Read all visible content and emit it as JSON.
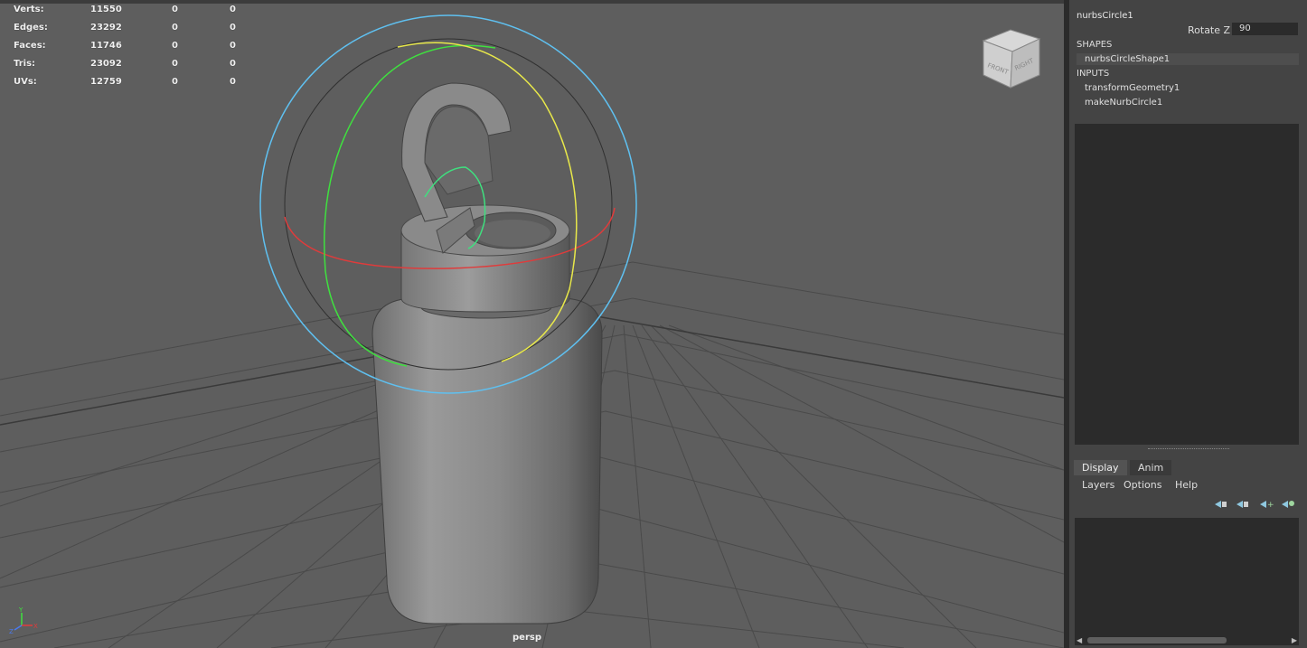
{
  "hud": {
    "rows": [
      {
        "label": "Verts:",
        "v1": "11550",
        "v2": "0",
        "v3": "0"
      },
      {
        "label": "Edges:",
        "v1": "23292",
        "v2": "0",
        "v3": "0"
      },
      {
        "label": "Faces:",
        "v1": "11746",
        "v2": "0",
        "v3": "0"
      },
      {
        "label": "Tris:",
        "v1": "23092",
        "v2": "0",
        "v3": "0"
      },
      {
        "label": "UVs:",
        "v1": "12759",
        "v2": "0",
        "v3": "0"
      }
    ]
  },
  "viewport": {
    "camera_label": "persp",
    "viewcube": {
      "front": "FRONT",
      "right": "RIGHT"
    },
    "axis": {
      "y": "Y",
      "x": "X",
      "z": "Z"
    },
    "colors": {
      "background": "#5e5e5e",
      "grid": "#4a4a4a",
      "rotate_x": "#e03b3b",
      "rotate_y": "#3fe03f",
      "rotate_z": "#e8e84a",
      "view_ring": "#5fc0f0"
    }
  },
  "channel_box": {
    "object_name": "nurbsCircle1",
    "attribute": {
      "label": "Rotate Z",
      "value": "90"
    },
    "shapes_header": "SHAPES",
    "shape_node": "nurbsCircleShape1",
    "inputs_header": "INPUTS",
    "input_nodes": [
      "transformGeometry1",
      "makeNurbCircle1"
    ]
  },
  "layer_editor": {
    "tabs": [
      "Display",
      "Anim"
    ],
    "active_tab": "Display",
    "menus": [
      "Layers",
      "Options",
      "Help"
    ],
    "icons": [
      "move-layer-up-icon",
      "move-layer-down-icon",
      "new-layer-icon",
      "new-layer-from-selected-icon"
    ]
  }
}
